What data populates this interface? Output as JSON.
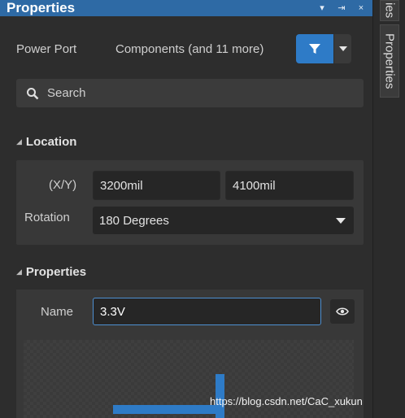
{
  "panel": {
    "title": "Properties",
    "controls": {
      "dropdown": "▾",
      "pin": "⇥",
      "close": "×"
    }
  },
  "header": {
    "object_kind": "Power Port",
    "filter_text": "Components (and 11 more)"
  },
  "search": {
    "placeholder": "Search"
  },
  "location": {
    "heading": "Location",
    "xy_label": "(X/Y)",
    "x_value": "3200mil",
    "y_value": "4100mil",
    "rotation_label": "Rotation",
    "rotation_value": "180 Degrees"
  },
  "properties": {
    "heading": "Properties",
    "name_label": "Name",
    "name_value": "3.3V"
  },
  "sidebar": {
    "tab_top": "ies",
    "tab_properties": "Properties"
  },
  "watermark": "https://blog.csdn.net/CaC_xukun",
  "colors": {
    "title_bar": "#2e6aa5",
    "accent": "#2e7bc7",
    "panel_bg": "#2d2d2d",
    "section_bg": "#383838"
  },
  "icons": [
    "filter-icon",
    "chevron-down-icon",
    "search-icon",
    "eye-icon",
    "collapse-triangle-icon"
  ]
}
